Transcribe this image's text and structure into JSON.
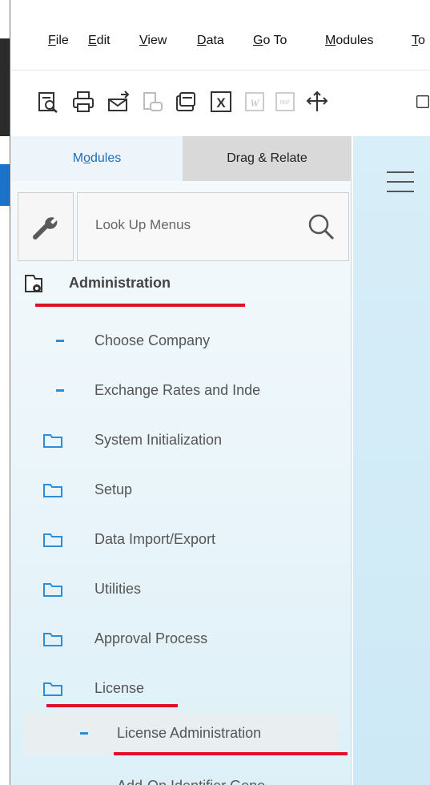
{
  "menubar": {
    "items": [
      {
        "accel": "F",
        "rest": "ile"
      },
      {
        "accel": "E",
        "rest": "dit"
      },
      {
        "accel": "V",
        "rest": "iew"
      },
      {
        "accel": "D",
        "rest": "ata"
      },
      {
        "accel": "G",
        "rest": "o To"
      },
      {
        "accel": "M",
        "rest": "odules"
      },
      {
        "accel": "T",
        "rest": "o"
      }
    ]
  },
  "toolbar": {
    "icons": [
      "preview-icon",
      "print-icon",
      "email-icon",
      "send-message-icon",
      "layers-icon",
      "excel-icon",
      "word-icon",
      "pdf-icon",
      "move-icon"
    ],
    "word_glyph": "W",
    "pdf_glyph": "PDF",
    "excel_glyph": "X"
  },
  "tabs": {
    "modules": "Modules",
    "drag_relate": "Drag & Relate"
  },
  "search": {
    "placeholder": "Look Up Menus"
  },
  "tree": {
    "root_label": "Administration",
    "items": [
      {
        "label": "Choose Company",
        "kind": "leaf"
      },
      {
        "label": "Exchange Rates and Inde",
        "kind": "leaf"
      },
      {
        "label": "System Initialization",
        "kind": "folder"
      },
      {
        "label": "Setup",
        "kind": "folder"
      },
      {
        "label": "Data Import/Export",
        "kind": "folder"
      },
      {
        "label": "Utilities",
        "kind": "folder"
      },
      {
        "label": "Approval Process",
        "kind": "folder"
      },
      {
        "label": "License",
        "kind": "folder"
      }
    ],
    "sub_items": [
      {
        "label": "License Administration",
        "selected": true
      },
      {
        "label": "Add-On Identifier Gene",
        "selected": false
      }
    ]
  },
  "colors": {
    "accent": "#1e6fb8",
    "dash": "#2a8fd8",
    "annotation": "#e0102a"
  }
}
